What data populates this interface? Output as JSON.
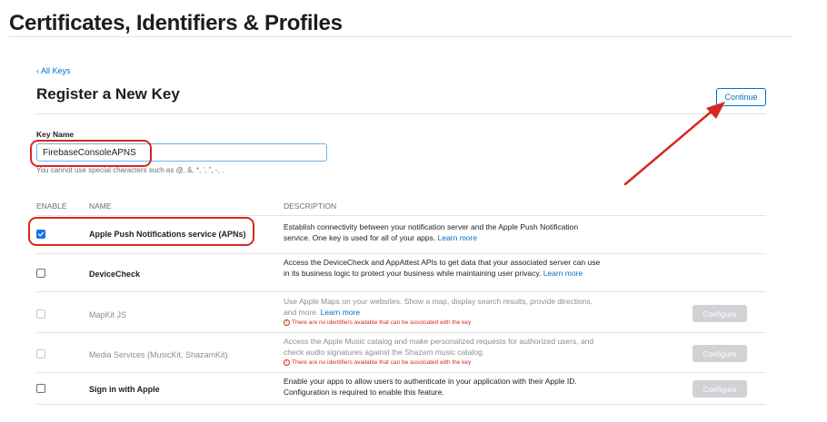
{
  "page": {
    "title": "Certificates, Identifiers & Profiles",
    "back_link": "‹ All Keys",
    "section_title": "Register a New Key",
    "continue_label": "Continue"
  },
  "key_form": {
    "label": "Key Name",
    "value": "FirebaseConsoleAPNS",
    "hint": "You cannot use special characters such as @, &, *, ', \", -, ."
  },
  "table": {
    "headers": {
      "enable": "ENABLE",
      "name": "NAME",
      "description": "DESCRIPTION"
    },
    "configure_label": "Configure",
    "learn_more": "Learn more",
    "warning_text": "There are no identifiers available that can be associated with the key",
    "rows": [
      {
        "name": "Apple Push Notifications service (APNs)",
        "checked": true,
        "enabled": true,
        "description": "Establish connectivity between your notification server and the Apple Push Notification service. One key is used for all of your apps."
      },
      {
        "name": "DeviceCheck",
        "checked": false,
        "enabled": true,
        "description": "Access the DeviceCheck and AppAttest APIs to get data that your associated server can use in its business logic to protect your business while maintaining user privacy."
      },
      {
        "name": "MapKit JS",
        "checked": false,
        "enabled": false,
        "description": "Use Apple Maps on your websites. Show a map, display search results, provide directions, and more."
      },
      {
        "name": "Media Services (MusicKit, ShazamKit)",
        "checked": false,
        "enabled": false,
        "description": "Access the Apple Music catalog and make personalized requests for authorized users, and check audio signatures against the Shazam music catalog."
      },
      {
        "name": "Sign in with Apple",
        "checked": false,
        "enabled": true,
        "description": "Enable your apps to allow users to authenticate in your application with their Apple ID. Configuration is required to enable this feature."
      }
    ]
  },
  "colors": {
    "accent": "#0070c9",
    "highlight": "#d6281f",
    "checkbox_checked": "#1a73e8",
    "configure_disabled": "#d1d1d6"
  },
  "icons": {
    "checkbox_checked": "checkmark-icon",
    "warning": "warning-icon",
    "annotation_arrow": "arrow-icon"
  }
}
